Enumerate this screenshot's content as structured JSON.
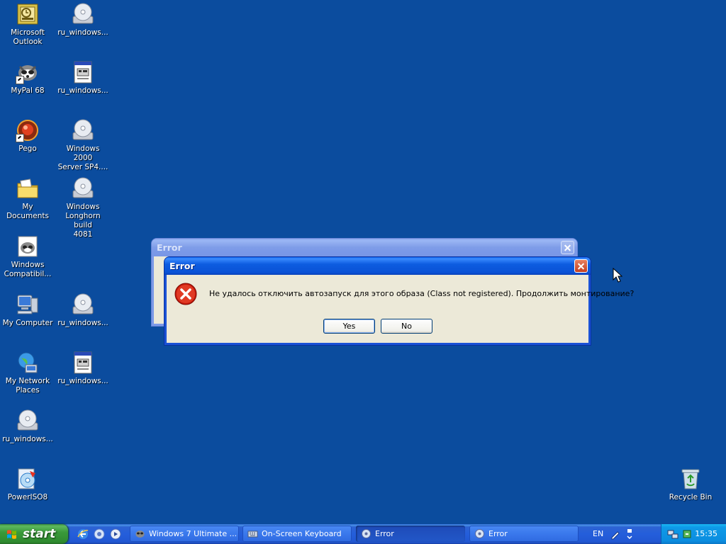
{
  "desktop_icons": [
    {
      "label": "Microsoft\nOutlook",
      "icon": "outlook-icon"
    },
    {
      "label": "ru_windows...",
      "icon": "cd-icon"
    },
    {
      "label": "MyPal 68",
      "icon": "mypal-icon"
    },
    {
      "label": "ru_windows...",
      "icon": "document-icon"
    },
    {
      "label": "Pego",
      "icon": "pego-icon"
    },
    {
      "label": "Windows 2000\nServer SP4....",
      "icon": "cd-icon"
    },
    {
      "label": "My Documents",
      "icon": "my-documents-icon"
    },
    {
      "label": "Windows\nLonghorn build\n4081",
      "icon": "cd-icon"
    },
    {
      "label": "Windows\nCompatibil...",
      "icon": "compatibility-icon"
    },
    {
      "label": "My Computer",
      "icon": "my-computer-icon"
    },
    {
      "label": "ru_windows...",
      "icon": "cd-icon"
    },
    {
      "label": "My Network\nPlaces",
      "icon": "network-icon"
    },
    {
      "label": "ru_windows...",
      "icon": "document-icon"
    },
    {
      "label": "ru_windows...",
      "icon": "cd-icon"
    },
    {
      "label": "PowerISO8",
      "icon": "poweriso-icon"
    },
    {
      "label": "Recycle Bin",
      "icon": "recycle-bin-icon"
    }
  ],
  "dialog_back": {
    "title": "Error"
  },
  "dialog_front": {
    "title": "Error",
    "message": "Не удалось отключить автозапуск для этого образа (Class not registered). Продолжить монтирование?",
    "yes_label": "Yes",
    "no_label": "No"
  },
  "taskbar": {
    "start_label": "start",
    "quick_launch": [
      "ie-icon",
      "firefox-icon",
      "media-icon"
    ],
    "tasks": [
      {
        "label": "Windows 7 Ultimate ...",
        "icon": "app-icon"
      },
      {
        "label": "On-Screen Keyboard",
        "icon": "keyboard-icon"
      },
      {
        "label": "Error",
        "icon": "disc-app-icon"
      },
      {
        "label": "Error",
        "icon": "disc-app-icon"
      }
    ],
    "language": "EN",
    "clock": "15:35"
  },
  "colors": {
    "desktop": "#0b4c9e",
    "titlebar": "#0a52d6",
    "dialog_bg": "#ece9d8",
    "taskbar": "#245edb",
    "start": "#3a9a3a"
  }
}
